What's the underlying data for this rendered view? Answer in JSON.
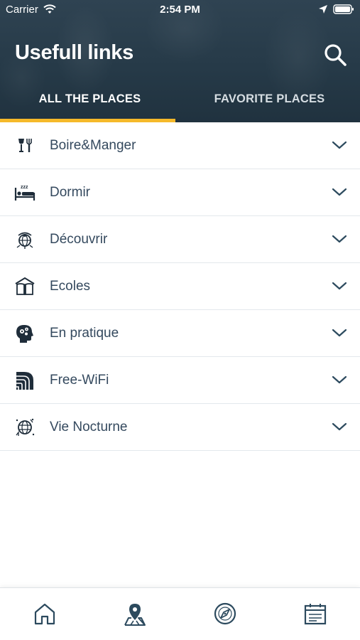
{
  "status_bar": {
    "carrier": "Carrier",
    "time": "2:54 PM",
    "icons": [
      "wifi-icon",
      "location-arrow-icon",
      "battery-icon"
    ]
  },
  "header": {
    "title": "Usefull links",
    "search_icon": "search-icon"
  },
  "tabs": [
    {
      "label": "ALL THE PLACES",
      "active": true
    },
    {
      "label": "FAVORITE PLACES",
      "active": false
    }
  ],
  "categories": [
    {
      "label": "Boire&Manger",
      "icon": "glass-and-fork-icon"
    },
    {
      "label": "Dormir",
      "icon": "bed-icon"
    },
    {
      "label": "Découvrir",
      "icon": "globe-eye-icon"
    },
    {
      "label": "Ecoles",
      "icon": "open-book-house-icon"
    },
    {
      "label": "En pratique",
      "icon": "head-gears-icon"
    },
    {
      "label": "Free-WiFi",
      "icon": "wifi-waves-icon"
    },
    {
      "label": "Vie Nocturne",
      "icon": "night-globe-icon"
    }
  ],
  "tabbar": {
    "items": [
      "home-icon",
      "map-pin-icon",
      "compass-icon",
      "calendar-icon"
    ]
  },
  "colors": {
    "header_bg": "#263a48",
    "accent": "#f5b92a",
    "text": "#34495e",
    "icon_stroke": "#2c4a5e"
  }
}
